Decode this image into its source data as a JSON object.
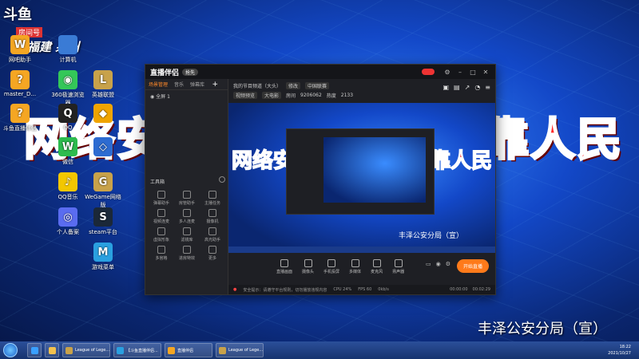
{
  "tv_logo": {
    "mark": "斗鱼",
    "room": "房间号",
    "room_number": "9206062",
    "brand": "福建 泉州"
  },
  "banner": {
    "left": "网络安",
    "right": "靠人民"
  },
  "desktop_icons": [
    {
      "label": "网吧助手",
      "color": "#f5a623",
      "glyph": "W"
    },
    {
      "label": "计算机",
      "color": "#3a7bd5",
      "glyph": ""
    },
    {
      "label": "master_D...",
      "color": "#f5a623",
      "glyph": "?"
    },
    {
      "label": "360极速浏览器",
      "color": "#34c759",
      "glyph": "◉"
    },
    {
      "label": "英雄联盟",
      "color": "#c8a24a",
      "glyph": "L"
    },
    {
      "label": "斗鱼直播伴侣",
      "color": "#f5a623",
      "glyph": "?"
    },
    {
      "label": "QQ",
      "color": "#222",
      "glyph": "Q"
    },
    {
      "label": "",
      "color": "#f0a400",
      "glyph": "◆"
    },
    {
      "label": "微信",
      "color": "#2dbb4e",
      "glyph": "W"
    },
    {
      "label": "",
      "color": "#2d6bd1",
      "glyph": "◇"
    },
    {
      "label": "QQ音乐",
      "color": "#f3c700",
      "glyph": "♪"
    },
    {
      "label": "WeGame网络版",
      "color": "#c8a24a",
      "glyph": "G"
    },
    {
      "label": "个人备案",
      "color": "#5a6cf0",
      "glyph": "◎"
    },
    {
      "label": "steam平台",
      "color": "#1b2838",
      "glyph": "S"
    },
    {
      "label": "游戏菜单",
      "color": "#2aa0e0",
      "glyph": "M"
    }
  ],
  "app_window": {
    "title": "直播伴侣",
    "version": "抢先",
    "left_tabs": [
      "场景管理",
      "音乐",
      "弹幕库"
    ],
    "scene_name": "全屏 1",
    "tools_title": "工具箱",
    "tools": [
      "弹幕助手",
      "房管助手",
      "主播任务",
      "视频连麦",
      "多人连麦",
      "摄像机",
      "虚拟形象",
      "滤镜库",
      "高光助手",
      "多宫格",
      "进房特效",
      "更多"
    ],
    "info": {
      "title": "我的节目频道（大头）",
      "category_btn": "修改",
      "category": "中国联赛",
      "tag1": "视频预览",
      "tag2": "大电影",
      "room_label": "房间",
      "room_id": "9206062",
      "hot_label": "热度",
      "hot_value": "2133"
    },
    "preview_caption": "丰泽公安分局（宣）",
    "controls": [
      "直播画面",
      "摄像头",
      "手机投屏",
      "多媒体",
      "麦克风",
      "扬声器"
    ],
    "start_button": "开始直播",
    "status": {
      "warning": "安全提示：请遵守平台规则，切勿播放违规内容",
      "cpu": "CPU 24%",
      "fps": "FPS 60",
      "bitrate": "0kb/s",
      "elapsed": "00:00:00",
      "clock": "00:02:29"
    }
  },
  "watermark": "丰泽公安分局（宣）",
  "taskbar": {
    "items": [
      {
        "label": "League of Lege...",
        "color": "#c8a24a"
      },
      {
        "label": "【斗鱼直播伴侣...",
        "color": "#2aa0e0"
      },
      {
        "label": "直播伴侣",
        "color": "#f5a623"
      },
      {
        "label": "League of Lege...",
        "color": "#c8a24a"
      }
    ],
    "time": "18:22",
    "date": "2021/10/27"
  }
}
